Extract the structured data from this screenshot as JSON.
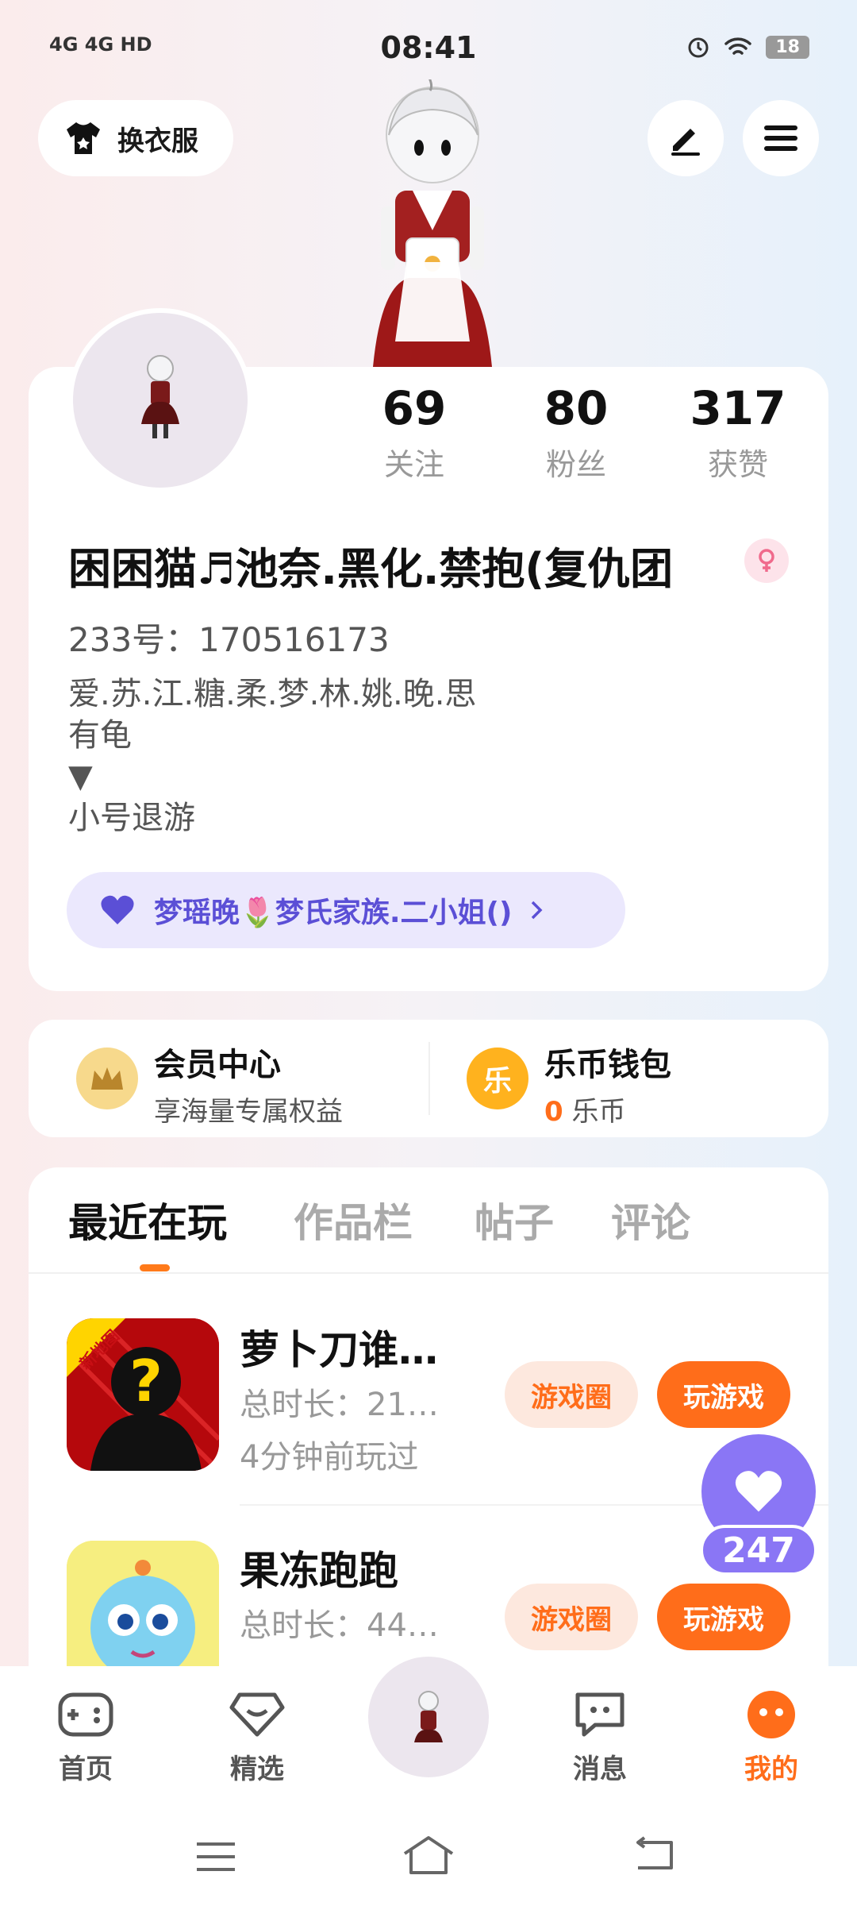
{
  "status_bar": {
    "signal_text": "4G 4G HD",
    "time": "08:41",
    "battery": "18"
  },
  "header": {
    "wardrobe_label": "换衣服"
  },
  "profile": {
    "stats": [
      {
        "num": "69",
        "label": "关注"
      },
      {
        "num": "80",
        "label": "粉丝"
      },
      {
        "num": "317",
        "label": "获赞"
      }
    ],
    "nickname": "困困猫♬池奈.黑化.禁抱(复仇团",
    "uid": "233号：170516173",
    "bio_lines": [
      "爱.苏.江.糖.柔.梦.林.姚.晚.思",
      "有龟",
      "▼",
      "小号退游"
    ],
    "family": "梦瑶晚🌷梦氏家族.二小姐()"
  },
  "vip": {
    "title": "会员中心",
    "subtitle": "享海量专属权益",
    "icon_char": ""
  },
  "wallet": {
    "title": "乐币钱包",
    "amount": "0",
    "unit": "乐币",
    "icon_char": "乐"
  },
  "tabs": [
    "最近在玩",
    "作品栏",
    "帖子",
    "评论"
  ],
  "games": [
    {
      "title": "萝卜刀谁…",
      "duration": "总时长：21…",
      "last_played": "4分钟前玩过",
      "badge": "新地图",
      "circle_label": "游戏圈",
      "play_label": "玩游戏"
    },
    {
      "title": "果冻跑跑",
      "duration": "总时长：44…",
      "last_played": "",
      "badge": "",
      "circle_label": "游戏圈",
      "play_label": "玩游戏"
    }
  ],
  "like_count": "247",
  "bottom_nav": [
    "首页",
    "精选",
    "消息",
    "我的"
  ],
  "colors": {
    "accent": "#ff6d1a",
    "purple": "#8a76f5",
    "family_text": "#5b4fd6"
  }
}
